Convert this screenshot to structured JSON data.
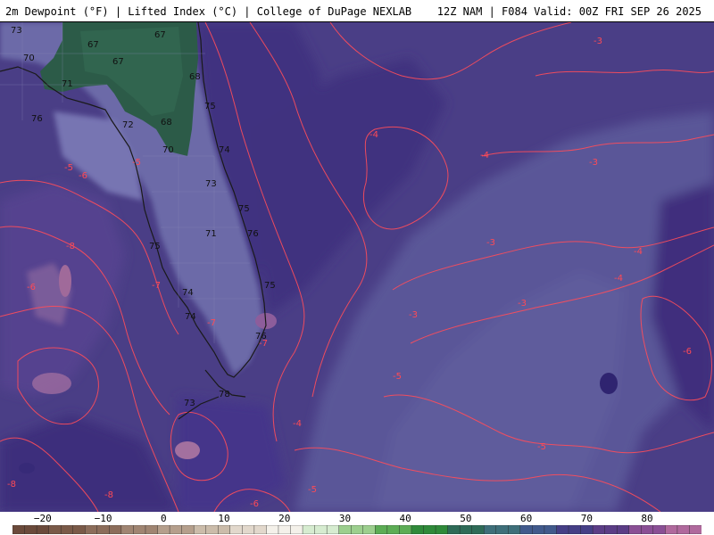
{
  "header": {
    "left_title": "2m Dewpoint (°F) | Lifted Index (°C) | College of DuPage NEXLAB",
    "right_title": "12Z NAM | F084 Valid: 00Z FRI SEP 26 2025"
  },
  "map": {
    "dewpoint_labels": [
      "69",
      "73",
      "67",
      "67",
      "70",
      "67",
      "71",
      "68",
      "76",
      "75",
      "72",
      "68",
      "70",
      "74",
      "73",
      "75",
      "71",
      "75",
      "76",
      "74",
      "74",
      "75",
      "76",
      "78",
      "73"
    ],
    "lifted_index_labels": [
      "-3",
      "-4",
      "-5",
      "-5",
      "-6",
      "-7",
      "-8",
      "-7",
      "-4",
      "-3",
      "-3",
      "-3",
      "-4",
      "-6",
      "-4",
      "-5",
      "-5",
      "-6",
      "-8",
      "-8",
      "-7",
      "-4",
      "-3",
      "-5",
      "-6"
    ]
  },
  "colorbar": {
    "ticks": [
      "−20",
      "−10",
      "0",
      "10",
      "20",
      "30",
      "40",
      "50",
      "60",
      "70",
      "80"
    ],
    "range": [
      -25,
      89
    ],
    "colors": [
      "#6b4a3b",
      "#7a5a48",
      "#8c6d5a",
      "#a08572",
      "#b59f8c",
      "#cbbcaa",
      "#e2d8cc",
      "#f4f1ea",
      "#d6ecd0",
      "#9ccf8e",
      "#5cad55",
      "#2f8a3a",
      "#2e6b57",
      "#3e6f7a",
      "#415a8c",
      "#453f86",
      "#5b3d86",
      "#8a4f95",
      "#b0699d"
    ]
  }
}
